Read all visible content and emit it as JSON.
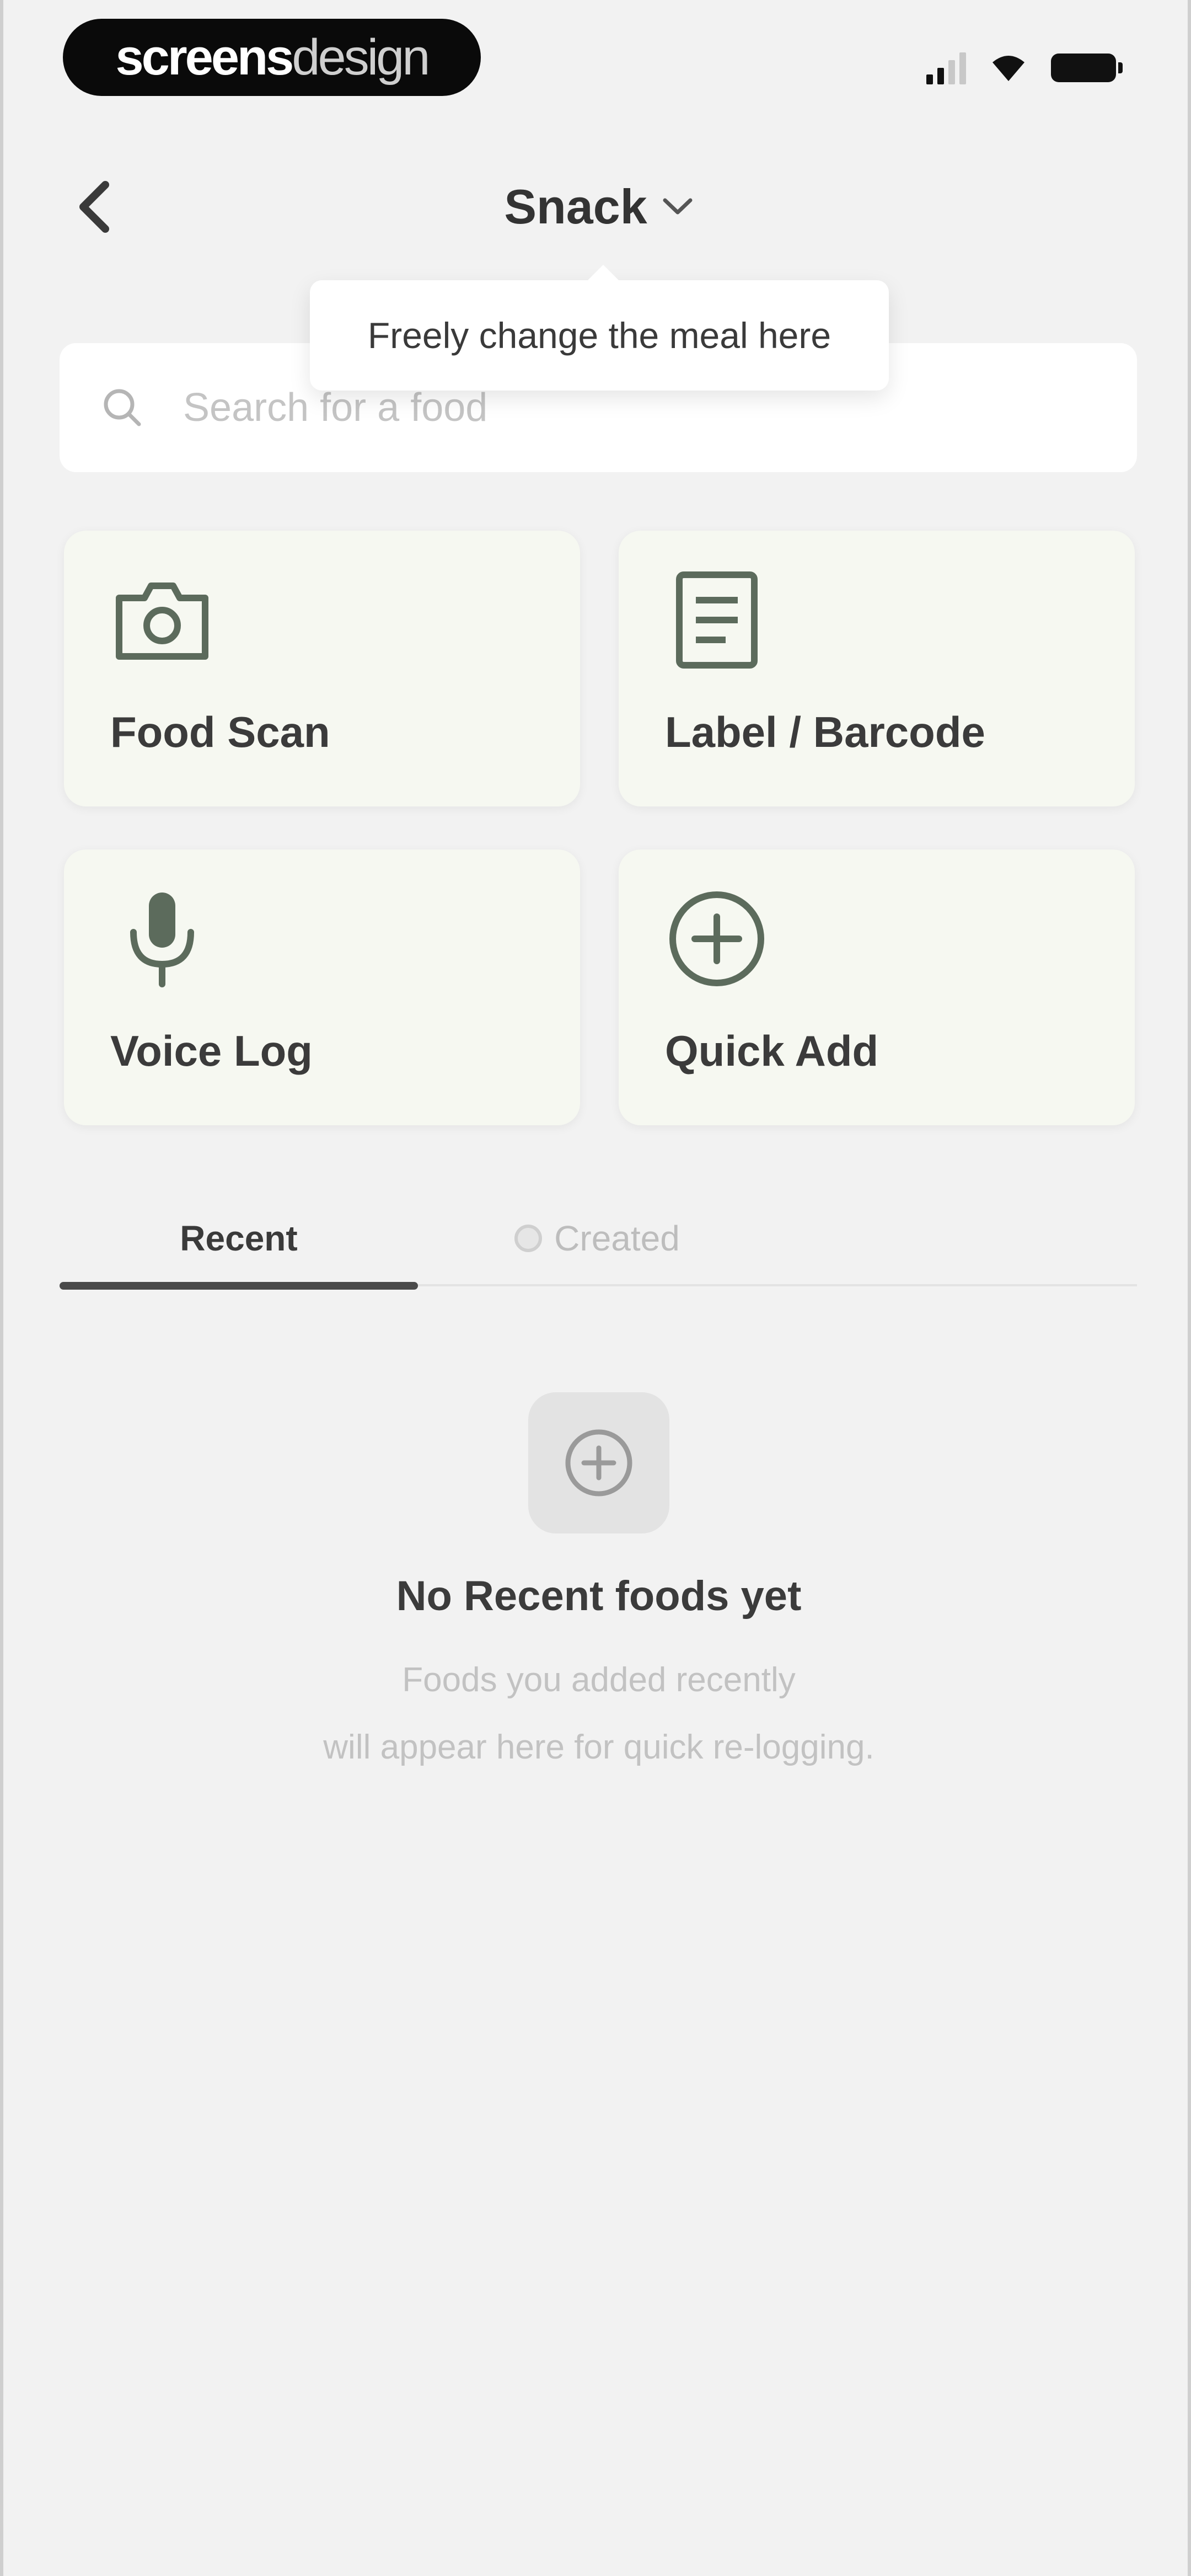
{
  "status_bar": {
    "brand_bold": "screens",
    "brand_light": "design",
    "signal_icon": "signal-icon",
    "wifi_icon": "wifi-icon",
    "battery_icon": "battery-icon"
  },
  "header": {
    "back_icon": "chevron-left-icon",
    "meal": "Snack",
    "dropdown_icon": "chevron-down-icon"
  },
  "tooltip": {
    "text": "Freely change the meal here"
  },
  "search": {
    "placeholder": "Search for a food",
    "value": "",
    "icon": "search-icon"
  },
  "actions": [
    {
      "label": "Food Scan",
      "icon": "camera-icon"
    },
    {
      "label": "Label / Barcode",
      "icon": "document-icon"
    },
    {
      "label": "Voice Log",
      "icon": "microphone-icon"
    },
    {
      "label": "Quick Add",
      "icon": "plus-circle-icon"
    }
  ],
  "tabs": [
    {
      "label": "Recent",
      "active": true
    },
    {
      "label": "Created",
      "active": false,
      "icon": "created-icon"
    }
  ],
  "empty_state": {
    "icon": "plus-circle-icon",
    "title": "No Recent foods yet",
    "line1": "Foods you added recently",
    "line2": "will appear here for quick re-logging."
  },
  "colors": {
    "background": "#f2f2f2",
    "card_background": "#f6f8f1",
    "icon_green": "#5c6b5c",
    "text_dark": "#333333",
    "text_muted": "#c2c2c2"
  }
}
